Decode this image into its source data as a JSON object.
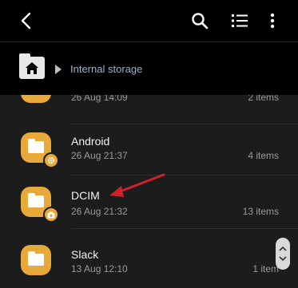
{
  "toolbar": {
    "back_icon": "back-arrow-icon",
    "search_icon": "search-icon",
    "list_view_icon": "list-view-icon",
    "more_icon": "more-vertical-icon"
  },
  "breadcrumb": {
    "home_icon": "home-folder-icon",
    "path_label": "Internal storage"
  },
  "folders": [
    {
      "name": "",
      "date": "26 Aug 14:09",
      "count": "2 items"
    },
    {
      "name": "Android",
      "date": "26 Aug 21:37",
      "count": "4 items",
      "badge": "gear-icon"
    },
    {
      "name": "DCIM",
      "date": "26 Aug 21:32",
      "count": "13 items",
      "badge": "camera-icon"
    },
    {
      "name": "Slack",
      "date": "13 Aug 12:10",
      "count": "1 item"
    }
  ],
  "colors": {
    "background": "#000000",
    "list_background": "#1c1c1c",
    "folder": "#e6a93a",
    "annotation_arrow": "#d0202a",
    "breadcrumb_text": "#9fb0c8"
  }
}
